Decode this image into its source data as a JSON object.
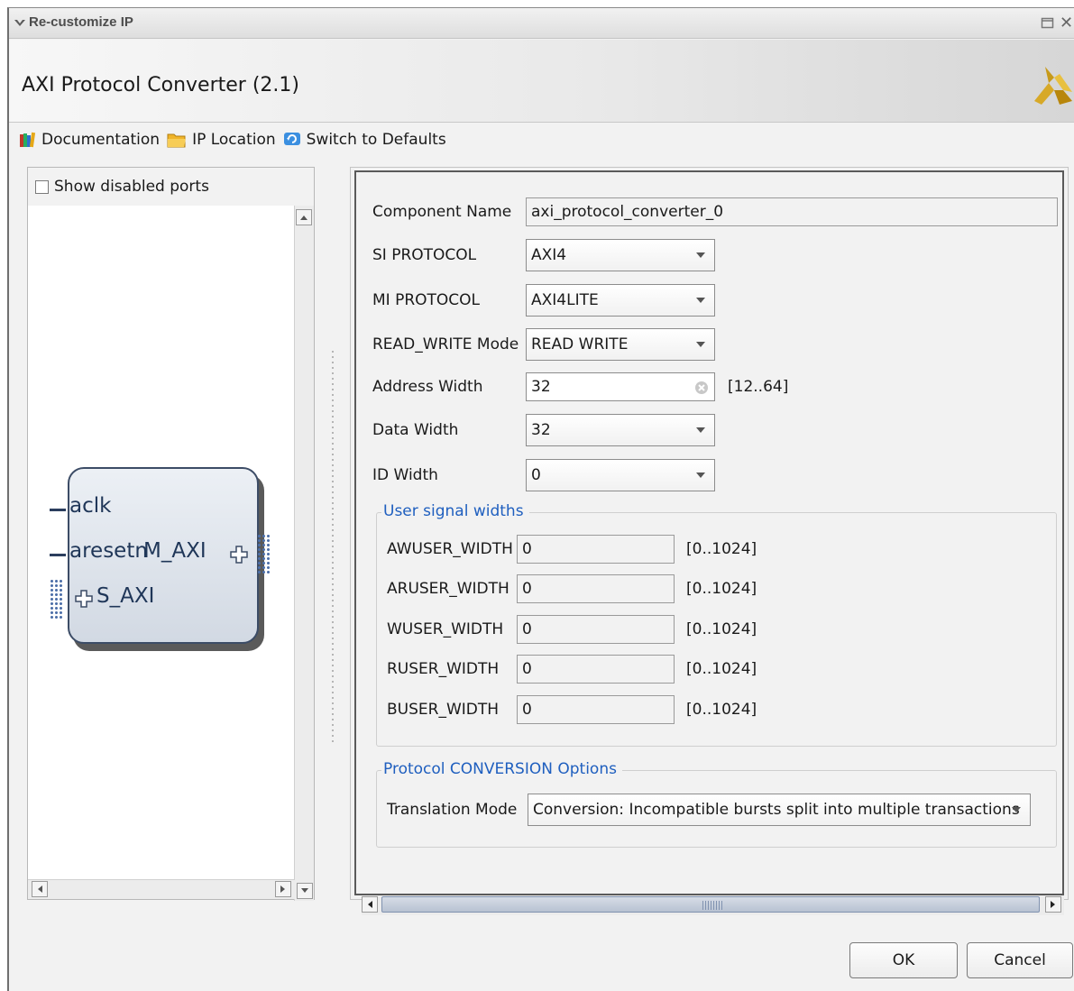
{
  "window": {
    "title": "Re-customize IP"
  },
  "header": {
    "title": "AXI Protocol Converter (2.1)"
  },
  "toolbar": {
    "documentation": "Documentation",
    "ip_location": "IP Location",
    "switch_defaults": "Switch to Defaults"
  },
  "left_panel": {
    "show_disabled_ports": "Show disabled ports",
    "ports": {
      "aclk": "aclk",
      "aresetn": "aresetn",
      "m_axi": "M_AXI",
      "s_axi": "S_AXI"
    }
  },
  "form": {
    "component_name_label": "Component Name",
    "component_name_value": "axi_protocol_converter_0",
    "si_protocol_label": "SI PROTOCOL",
    "si_protocol_value": "AXI4",
    "mi_protocol_label": "MI PROTOCOL",
    "mi_protocol_value": "AXI4LITE",
    "rw_mode_label": "READ_WRITE Mode",
    "rw_mode_value": "READ WRITE",
    "address_width_label": "Address Width",
    "address_width_value": "32",
    "address_width_range": "[12..64]",
    "data_width_label": "Data Width",
    "data_width_value": "32",
    "id_width_label": "ID Width",
    "id_width_value": "0"
  },
  "user_signal_widths": {
    "title": "User signal widths",
    "rows": [
      {
        "label": "AWUSER_WIDTH",
        "value": "0",
        "range": "[0..1024]"
      },
      {
        "label": "ARUSER_WIDTH",
        "value": "0",
        "range": "[0..1024]"
      },
      {
        "label": "WUSER_WIDTH",
        "value": "0",
        "range": "[0..1024]"
      },
      {
        "label": "RUSER_WIDTH",
        "value": "0",
        "range": "[0..1024]"
      },
      {
        "label": "BUSER_WIDTH",
        "value": "0",
        "range": "[0..1024]"
      }
    ]
  },
  "conversion": {
    "title": "Protocol CONVERSION Options",
    "translation_mode_label": "Translation Mode",
    "translation_mode_value": "Conversion: Incompatible bursts split into multiple transactions"
  },
  "buttons": {
    "ok": "OK",
    "cancel": "Cancel"
  },
  "icons": {
    "collapse": "chevron-down-icon",
    "restore": "restore-window-icon",
    "close": "close-icon",
    "logo": "xilinx-logo-icon",
    "documentation": "books-icon",
    "ip_location": "folder-icon",
    "switch_defaults": "refresh-icon"
  },
  "colors": {
    "group_title": "#1f5fbf",
    "block_border": "#3c4c66",
    "port_text": "#1f3658"
  }
}
